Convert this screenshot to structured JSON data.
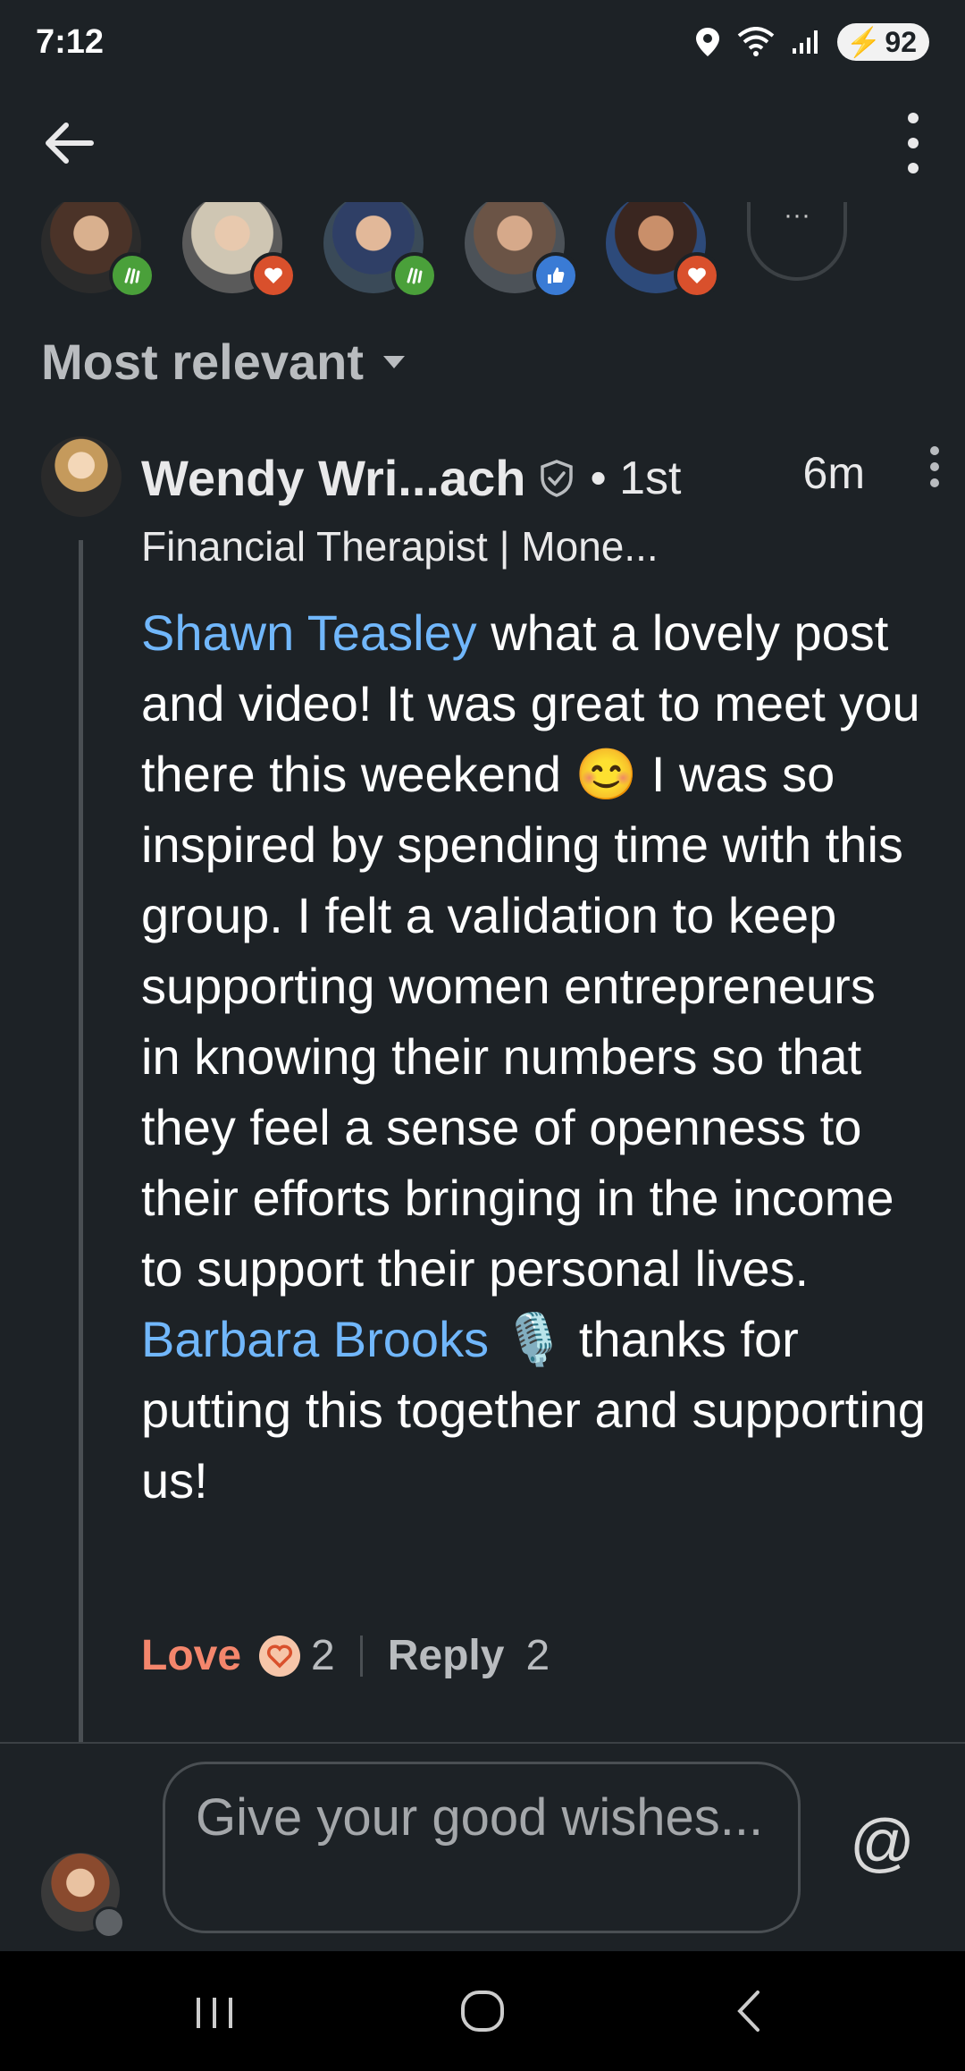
{
  "status_bar": {
    "time": "7:12",
    "battery": "92"
  },
  "header": {
    "back_icon": "arrow-left-icon",
    "menu_icon": "more-vertical-icon"
  },
  "reactors": [
    {
      "badge": "celebrate",
      "badge_color": "#4aa03a"
    },
    {
      "badge": "love",
      "badge_color": "#d9502c"
    },
    {
      "badge": "celebrate",
      "badge_color": "#4aa03a"
    },
    {
      "badge": "like",
      "badge_color": "#3a7bd5"
    },
    {
      "badge": "love",
      "badge_color": "#d9502c"
    }
  ],
  "reactors_more": "···",
  "sort": {
    "label": "Most relevant"
  },
  "comment": {
    "author": "Wendy Wri...ach",
    "degree": "• 1st",
    "time": "6m",
    "headline": "Financial Therapist | Mone...",
    "mention1": "Shawn Teasley",
    "body1": " what a lovely post and video!  It was great to meet you there this weekend 😊 I was so inspired by spending time with this group.  I felt a validation to keep supporting women entrepreneurs in knowing their numbers so that they feel a sense of openness to their efforts bringing in the income to support their personal lives.  ",
    "mention2": "Barbara Brooks",
    "body2": " 🎙️ thanks for putting this together and supporting us!",
    "love_label": "Love",
    "love_count": "2",
    "reply_label": "Reply",
    "reply_count": "2"
  },
  "composer": {
    "placeholder": "Give your good wishes...",
    "at_symbol": "@"
  },
  "colors": {
    "background": "#1d2226",
    "link": "#71b7fb",
    "love": "#f4866c"
  }
}
